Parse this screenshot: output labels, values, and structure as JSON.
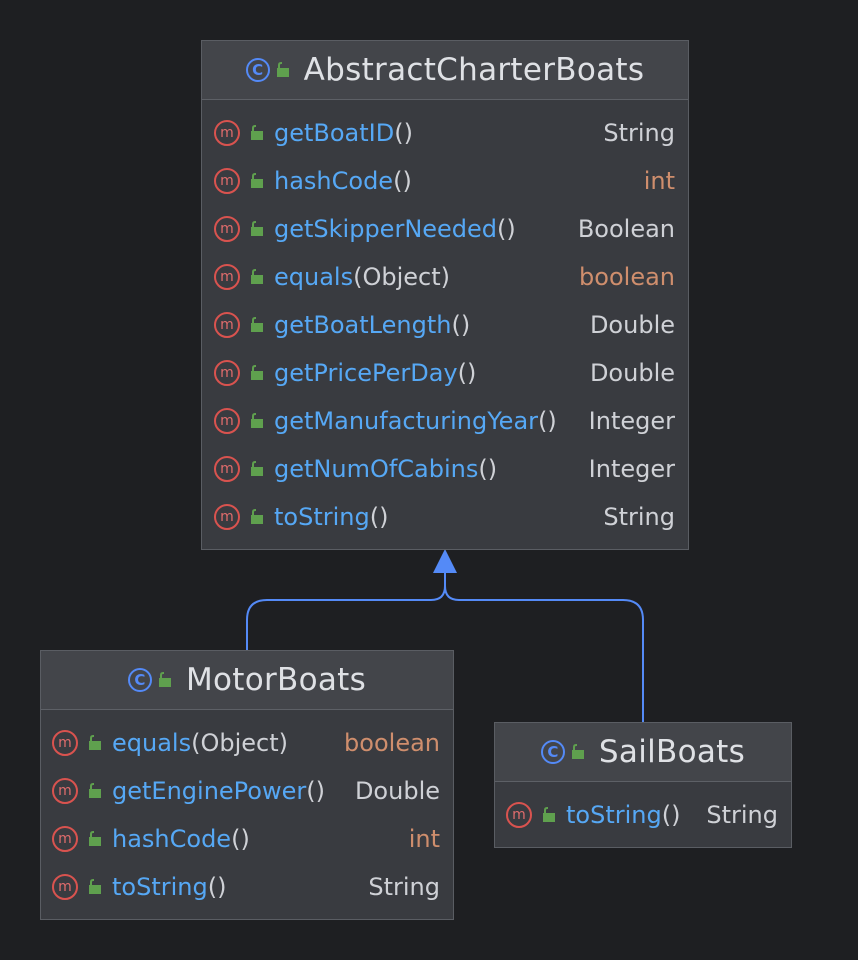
{
  "colors": {
    "background": "#1e1f22",
    "class_icon": "#548af7",
    "method_icon": "#d9534f",
    "lock_icon": "#5fa04e",
    "method_name": "#56a8f5",
    "primitive_type": "#cf8e6d",
    "edge": "#548af7"
  },
  "classes": [
    {
      "name": "AbstractCharterBoats",
      "icon": "class-icon",
      "methods": [
        {
          "name": "getBoatID",
          "params": "()",
          "return": "String",
          "primitive": false
        },
        {
          "name": "hashCode",
          "params": "()",
          "return": "int",
          "primitive": true
        },
        {
          "name": "getSkipperNeeded",
          "params": "()",
          "return": "Boolean",
          "primitive": false
        },
        {
          "name": "equals",
          "params": "(Object)",
          "return": "boolean",
          "primitive": true
        },
        {
          "name": "getBoatLength",
          "params": "()",
          "return": "Double",
          "primitive": false
        },
        {
          "name": "getPricePerDay",
          "params": "()",
          "return": "Double",
          "primitive": false
        },
        {
          "name": "getManufacturingYear",
          "params": "()",
          "return": "Integer",
          "primitive": false
        },
        {
          "name": "getNumOfCabins",
          "params": "()",
          "return": "Integer",
          "primitive": false
        },
        {
          "name": "toString",
          "params": "()",
          "return": "String",
          "primitive": false
        }
      ]
    },
    {
      "name": "MotorBoats",
      "icon": "class-icon",
      "methods": [
        {
          "name": "equals",
          "params": "(Object)",
          "return": "boolean",
          "primitive": true
        },
        {
          "name": "getEnginePower",
          "params": "()",
          "return": "Double",
          "primitive": false
        },
        {
          "name": "hashCode",
          "params": "()",
          "return": "int",
          "primitive": true
        },
        {
          "name": "toString",
          "params": "()",
          "return": "String",
          "primitive": false
        }
      ]
    },
    {
      "name": "SailBoats",
      "icon": "class-icon",
      "methods": [
        {
          "name": "toString",
          "params": "()",
          "return": "String",
          "primitive": false
        }
      ]
    }
  ],
  "relations": [
    {
      "from": "MotorBoats",
      "to": "AbstractCharterBoats",
      "type": "extends"
    },
    {
      "from": "SailBoats",
      "to": "AbstractCharterBoats",
      "type": "extends"
    }
  ],
  "icons": {
    "class_glyph": "C",
    "method_glyph": "m"
  }
}
